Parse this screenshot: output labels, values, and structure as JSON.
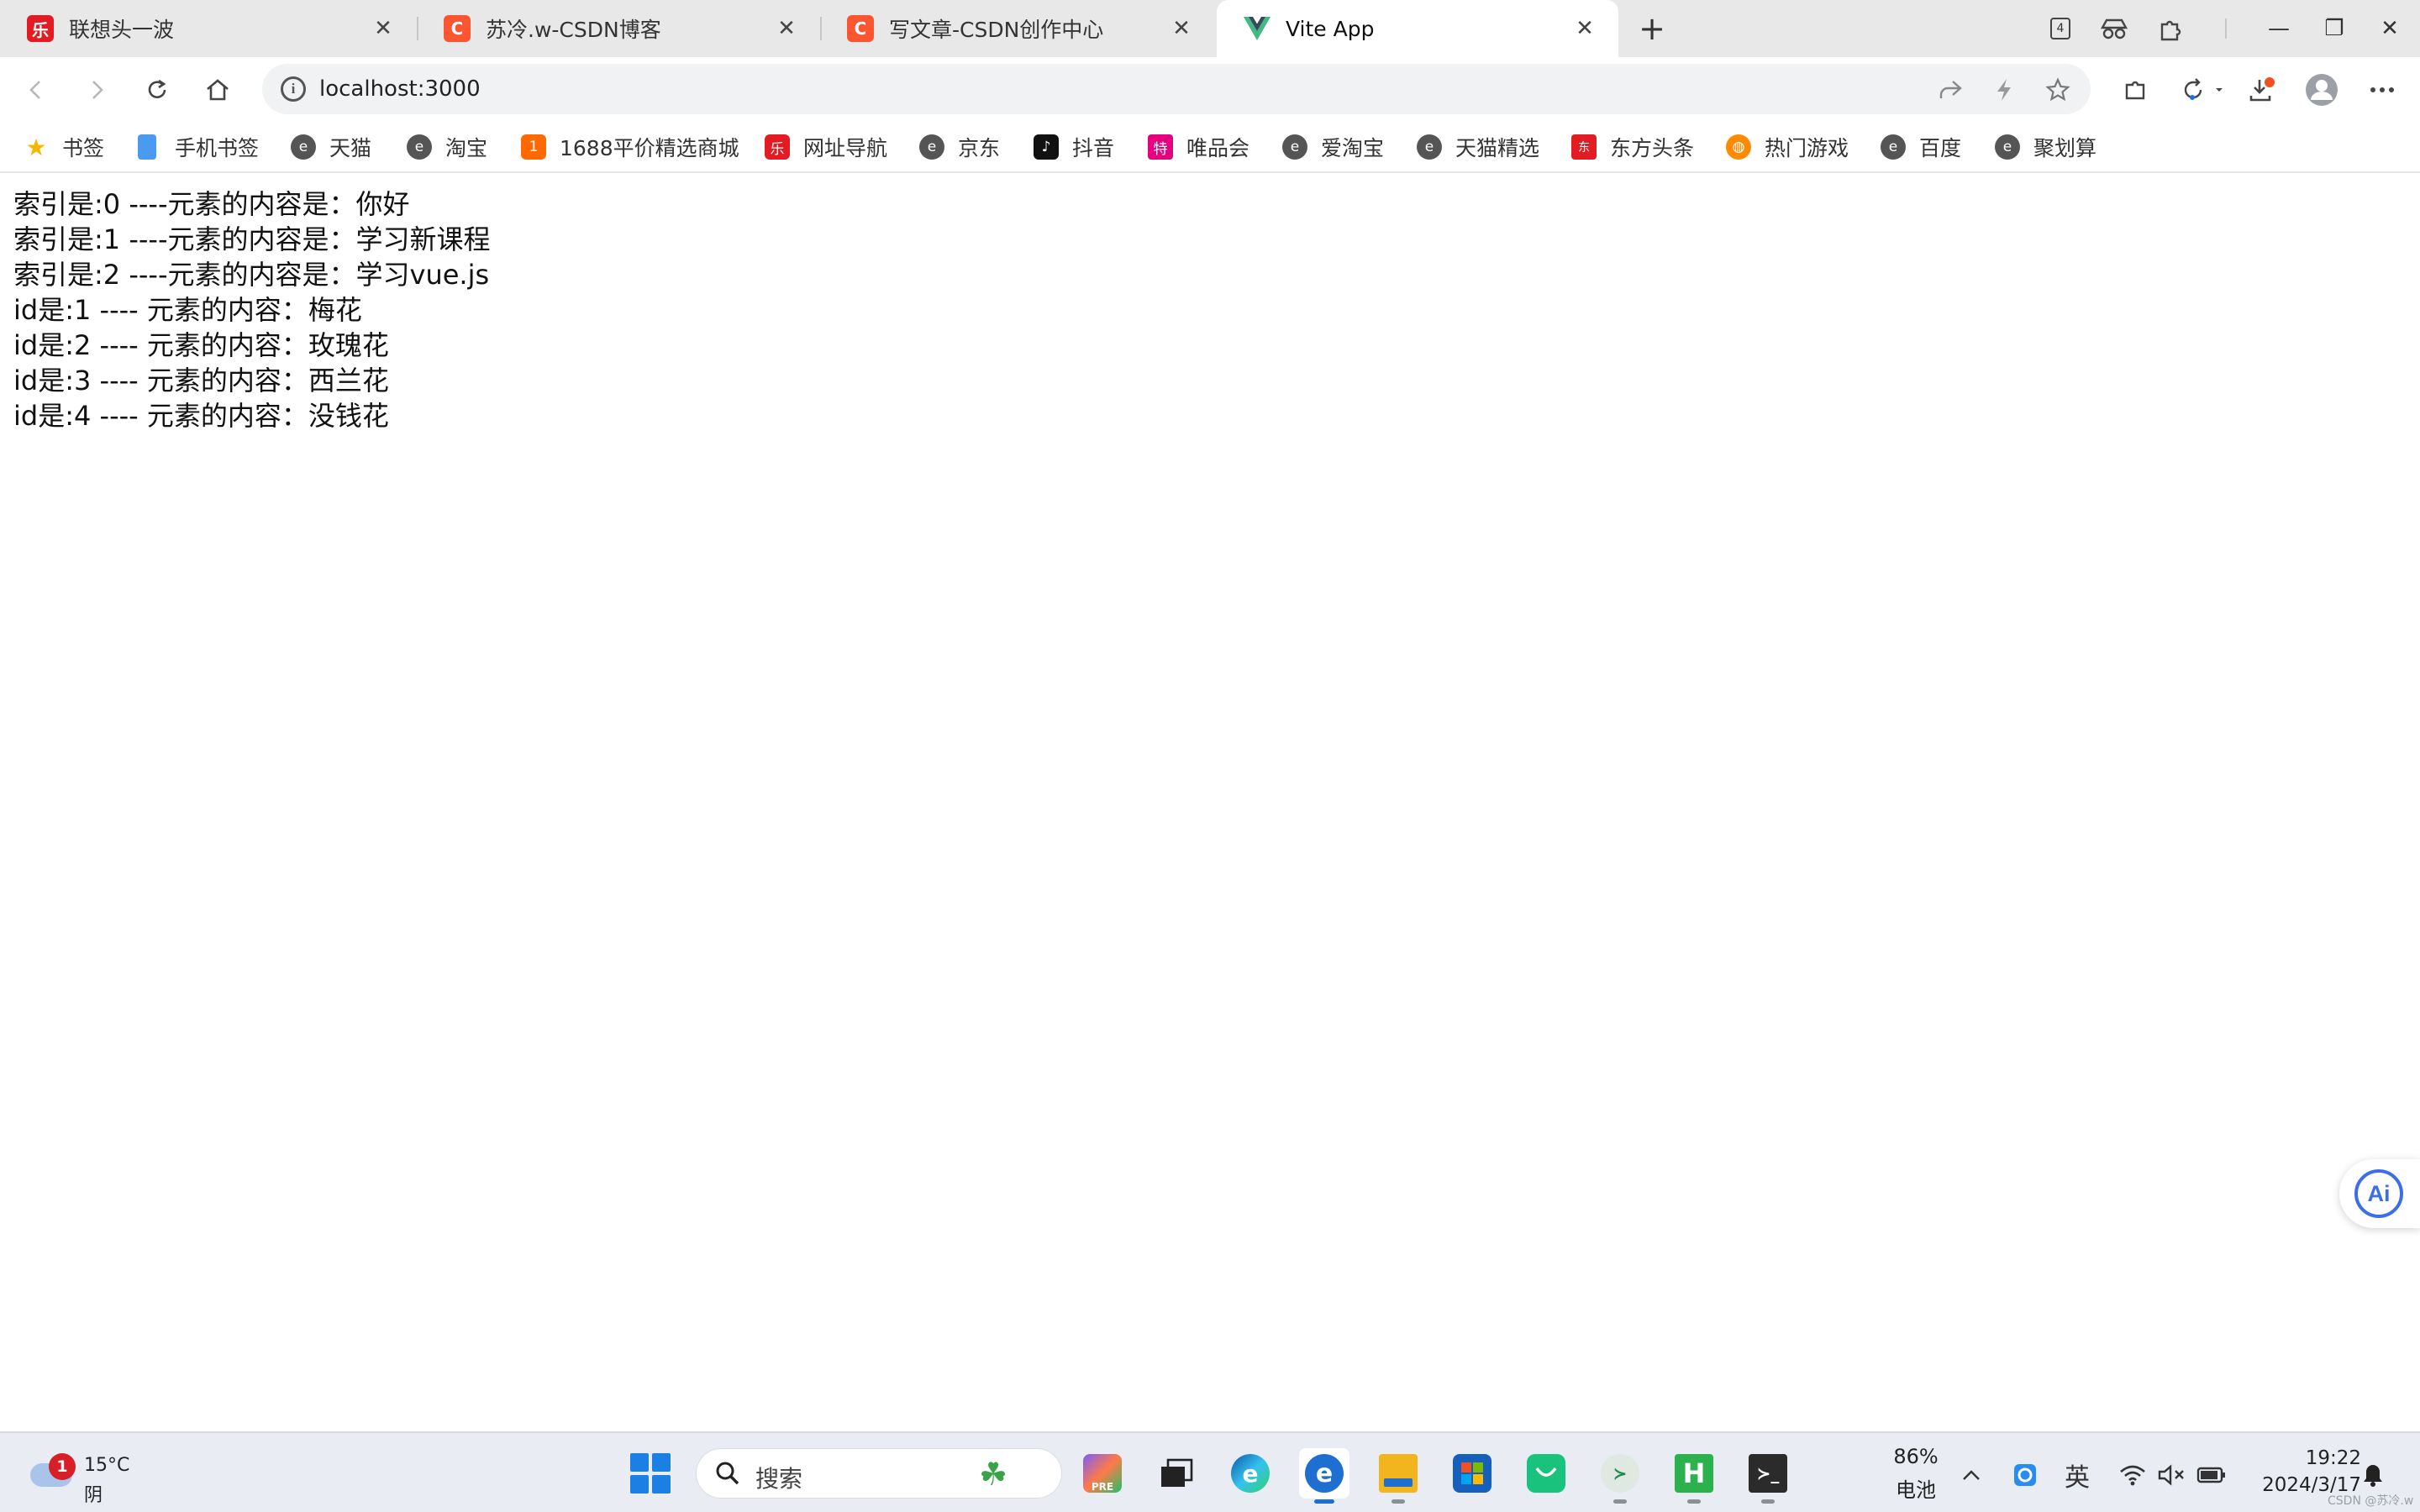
{
  "browser": {
    "tabs": [
      {
        "title": "联想头一波",
        "favicon_color": "#e31b23",
        "favicon_glyph": "乐",
        "active": false
      },
      {
        "title": "苏冷.w-CSDN博客",
        "favicon_color": "#fc5531",
        "favicon_glyph": "C",
        "active": false
      },
      {
        "title": "写文章-CSDN创作中心",
        "favicon_color": "#fc5531",
        "favicon_glyph": "C",
        "active": false
      },
      {
        "title": "Vite App",
        "favicon_color": "#42b883",
        "favicon_glyph": "V",
        "active": true
      }
    ],
    "tab_close_glyph": "✕",
    "new_tab_glyph": "+",
    "tab_count_badge": "4",
    "window_controls": {
      "minimize": "—",
      "maximize": "❐",
      "close": "✕"
    },
    "address": {
      "url": "localhost:3000",
      "info_glyph": "i"
    },
    "nav_glyphs": {
      "back": "‹",
      "forward": "›",
      "reload": "↻",
      "home": "⌂"
    },
    "bookmarks": [
      {
        "label": "书签",
        "icon": "star-icon",
        "color": "#f5b800",
        "glyph": "★"
      },
      {
        "label": "手机书签",
        "icon": "phone-icon",
        "color": "#4a9bf0",
        "glyph": "▮"
      },
      {
        "label": "天猫",
        "icon": "ie-icon",
        "color": "#555555",
        "glyph": "e"
      },
      {
        "label": "淘宝",
        "icon": "ie-icon",
        "color": "#555555",
        "glyph": "e"
      },
      {
        "label": "1688平价精选商城",
        "icon": "1688-icon",
        "color": "#ff6a00",
        "glyph": "1"
      },
      {
        "label": "网址导航",
        "icon": "lenovo-icon",
        "color": "#e31b23",
        "glyph": "乐"
      },
      {
        "label": "京东",
        "icon": "ie-icon",
        "color": "#555555",
        "glyph": "e"
      },
      {
        "label": "抖音",
        "icon": "douyin-icon",
        "color": "#111111",
        "glyph": "♪"
      },
      {
        "label": "唯品会",
        "icon": "vip-icon",
        "color": "#e4007f",
        "glyph": "特"
      },
      {
        "label": "爱淘宝",
        "icon": "ie-icon",
        "color": "#555555",
        "glyph": "e"
      },
      {
        "label": "天猫精选",
        "icon": "ie-icon",
        "color": "#555555",
        "glyph": "e"
      },
      {
        "label": "东方头条",
        "icon": "dftt-icon",
        "color": "#e31b23",
        "glyph": "东"
      },
      {
        "label": "热门游戏",
        "icon": "game-icon",
        "color": "#ff8a00",
        "glyph": "◍"
      },
      {
        "label": "百度",
        "icon": "ie-icon",
        "color": "#555555",
        "glyph": "e"
      },
      {
        "label": "聚划算",
        "icon": "ie-icon",
        "color": "#555555",
        "glyph": "e"
      }
    ]
  },
  "page": {
    "lines": [
      "索引是:0 ----元素的内容是：你好",
      "索引是:1 ----元素的内容是：学习新课程",
      "索引是:2 ----元素的内容是：学习vue.js",
      "id是:1 ---- 元素的内容：梅花",
      "id是:2 ---- 元素的内容：玫瑰花",
      "id是:3 ---- 元素的内容：西兰花",
      "id是:4 ---- 元素的内容：没钱花"
    ],
    "ai_button_label": "Ai"
  },
  "taskbar": {
    "weather": {
      "temp": "15°C",
      "condition": "阴",
      "badge": "1"
    },
    "search_placeholder": "搜索",
    "apps": [
      {
        "name": "copilot-icon",
        "color": "#7b5cff",
        "glyph": "✦",
        "label": "PRE"
      },
      {
        "name": "task-view-icon",
        "color": "#222222",
        "glyph": "▣"
      },
      {
        "name": "edge-icon",
        "color": "#1a8ad4",
        "glyph": "e"
      },
      {
        "name": "ie-browser-icon",
        "color": "#1f6fd1",
        "glyph": "e"
      },
      {
        "name": "file-explorer-icon",
        "color": "#f2b51d",
        "glyph": "▬"
      },
      {
        "name": "ms-store-icon",
        "color": "#1560bd",
        "glyph": "▦"
      },
      {
        "name": "shop-bag-icon",
        "color": "#19c37d",
        "glyph": "◡"
      },
      {
        "name": "assistant-icon",
        "color": "#cfe3d6",
        "glyph": "≻"
      },
      {
        "name": "hbuilder-icon",
        "color": "#2bb24c",
        "glyph": "H"
      },
      {
        "name": "terminal-icon",
        "color": "#2b2b2b",
        "glyph": "≻_"
      }
    ],
    "battery": {
      "percent": "86%",
      "label": "电池"
    },
    "ime": "英",
    "time": "19:22",
    "date": "2024/3/17"
  },
  "watermark": "CSDN @苏冷.w"
}
